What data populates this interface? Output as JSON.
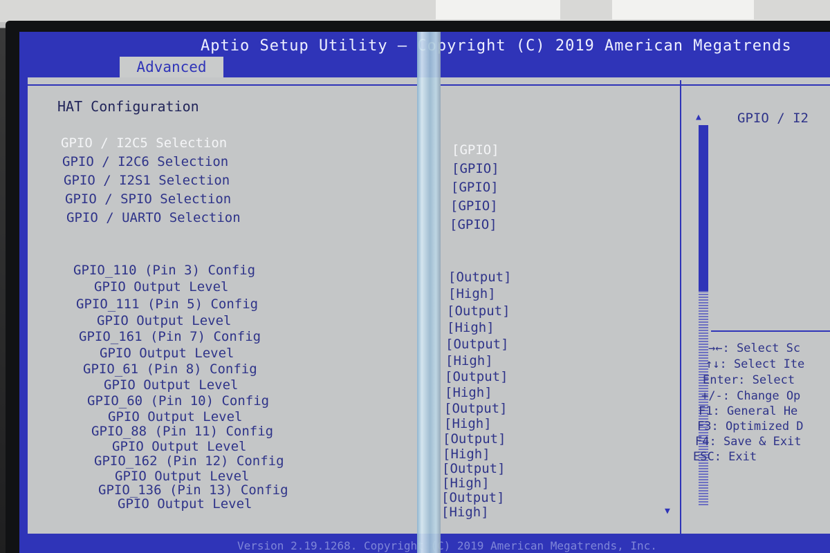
{
  "header": {
    "title": "Aptio Setup Utility – Copyright (C) 2019 American Megatrends",
    "tab": "Advanced"
  },
  "page": {
    "section_title": "HAT Configuration",
    "items": [
      {
        "label": "GPIO / I2C5 Selection",
        "value": "[GPIO]"
      },
      {
        "label": "GPIO / I2C6 Selection",
        "value": "[GPIO]"
      },
      {
        "label": "GPIO / I2S1 Selection",
        "value": "[GPIO]"
      },
      {
        "label": "GPIO / SPIO Selection",
        "value": "[GPIO]"
      },
      {
        "label": "GPIO / UARTO Selection",
        "value": "[GPIO]"
      },
      {
        "label": "GPIO_110   (Pin 3) Config",
        "value": "[Output]"
      },
      {
        "label": "GPIO Output Level",
        "value": "[High]"
      },
      {
        "label": "GPIO_111   (Pin 5) Config",
        "value": "[Output]"
      },
      {
        "label": "GPIO Output Level",
        "value": "[High]"
      },
      {
        "label": "GPIO_161   (Pin 7) Config",
        "value": "[Output]"
      },
      {
        "label": "GPIO Output Level",
        "value": "[High]"
      },
      {
        "label": "GPIO_61    (Pin 8) Config",
        "value": "[Output]"
      },
      {
        "label": "GPIO Output Level",
        "value": "[High]"
      },
      {
        "label": "GPIO_60    (Pin 10) Config",
        "value": "[Output]"
      },
      {
        "label": "GPIO Output Level",
        "value": "[High]"
      },
      {
        "label": "GPIO_88    (Pin 11) Config",
        "value": "[Output]"
      },
      {
        "label": "GPIO Output Level",
        "value": "[High]"
      },
      {
        "label": "GPIO_162   (Pin 12) Config",
        "value": "[Output]"
      },
      {
        "label": "GPIO Output Level",
        "value": "[High]"
      },
      {
        "label": "GPIO_136   (Pin 13) Config",
        "value": "[Output]"
      },
      {
        "label": "GPIO Output Level",
        "value": "[High]"
      }
    ]
  },
  "help": {
    "title": "GPIO / I2",
    "keys": [
      "→←: Select Sc",
      "↑↓: Select Ite",
      "Enter: Select",
      "+/-: Change Op",
      "F1: General He",
      "F3: Optimized D",
      "F4: Save & Exit",
      "ESC: Exit"
    ]
  },
  "footer": {
    "text": "Version 2.19.1268. Copyright (C) 2019 American Megatrends, Inc."
  },
  "colors": {
    "bios_blue": "#2f34b8",
    "panel_gray": "#c4c6c7",
    "highlight_white": "#f4f5f7"
  }
}
